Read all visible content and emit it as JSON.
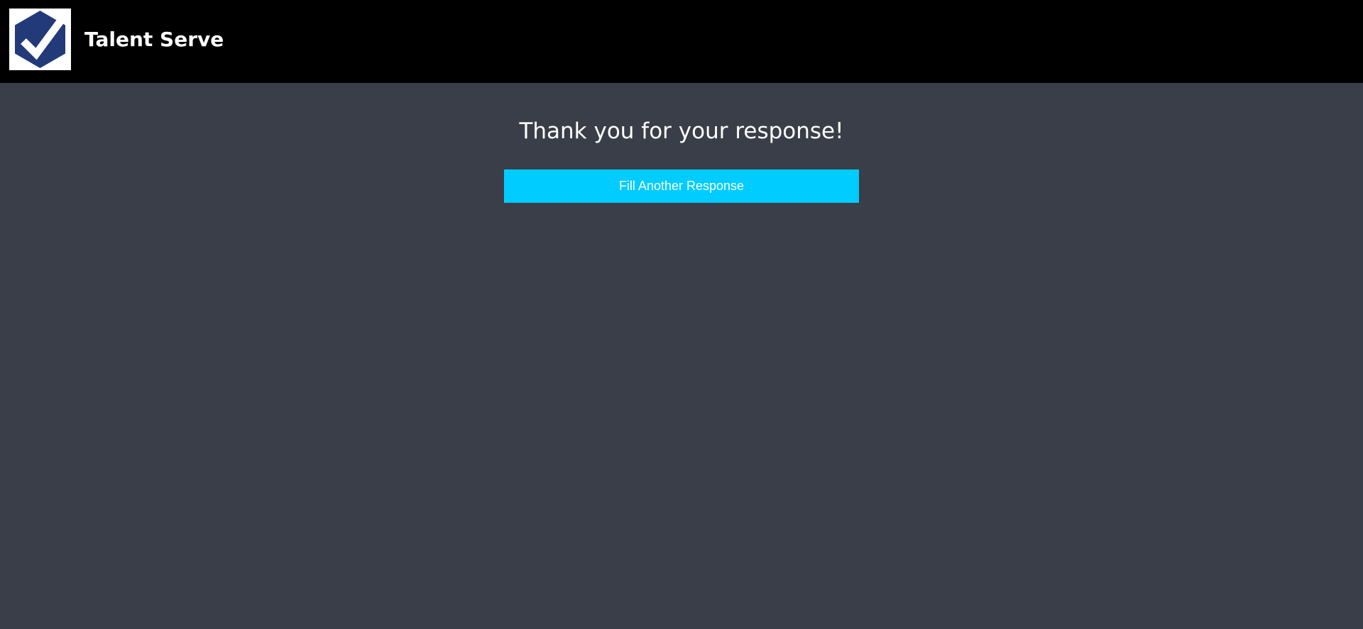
{
  "header": {
    "brand_name": "Talent Serve",
    "logo_icon": "hexagon-checkmark-icon",
    "colors": {
      "background": "#000000",
      "logo_hexagon": "#233a7a",
      "logo_check": "#ffffff"
    }
  },
  "main": {
    "message": "Thank you for your response!",
    "fill_another_label": "Fill Another Response",
    "colors": {
      "background": "#3a3e48",
      "button": "#00ccff",
      "text": "#ffffff"
    }
  }
}
